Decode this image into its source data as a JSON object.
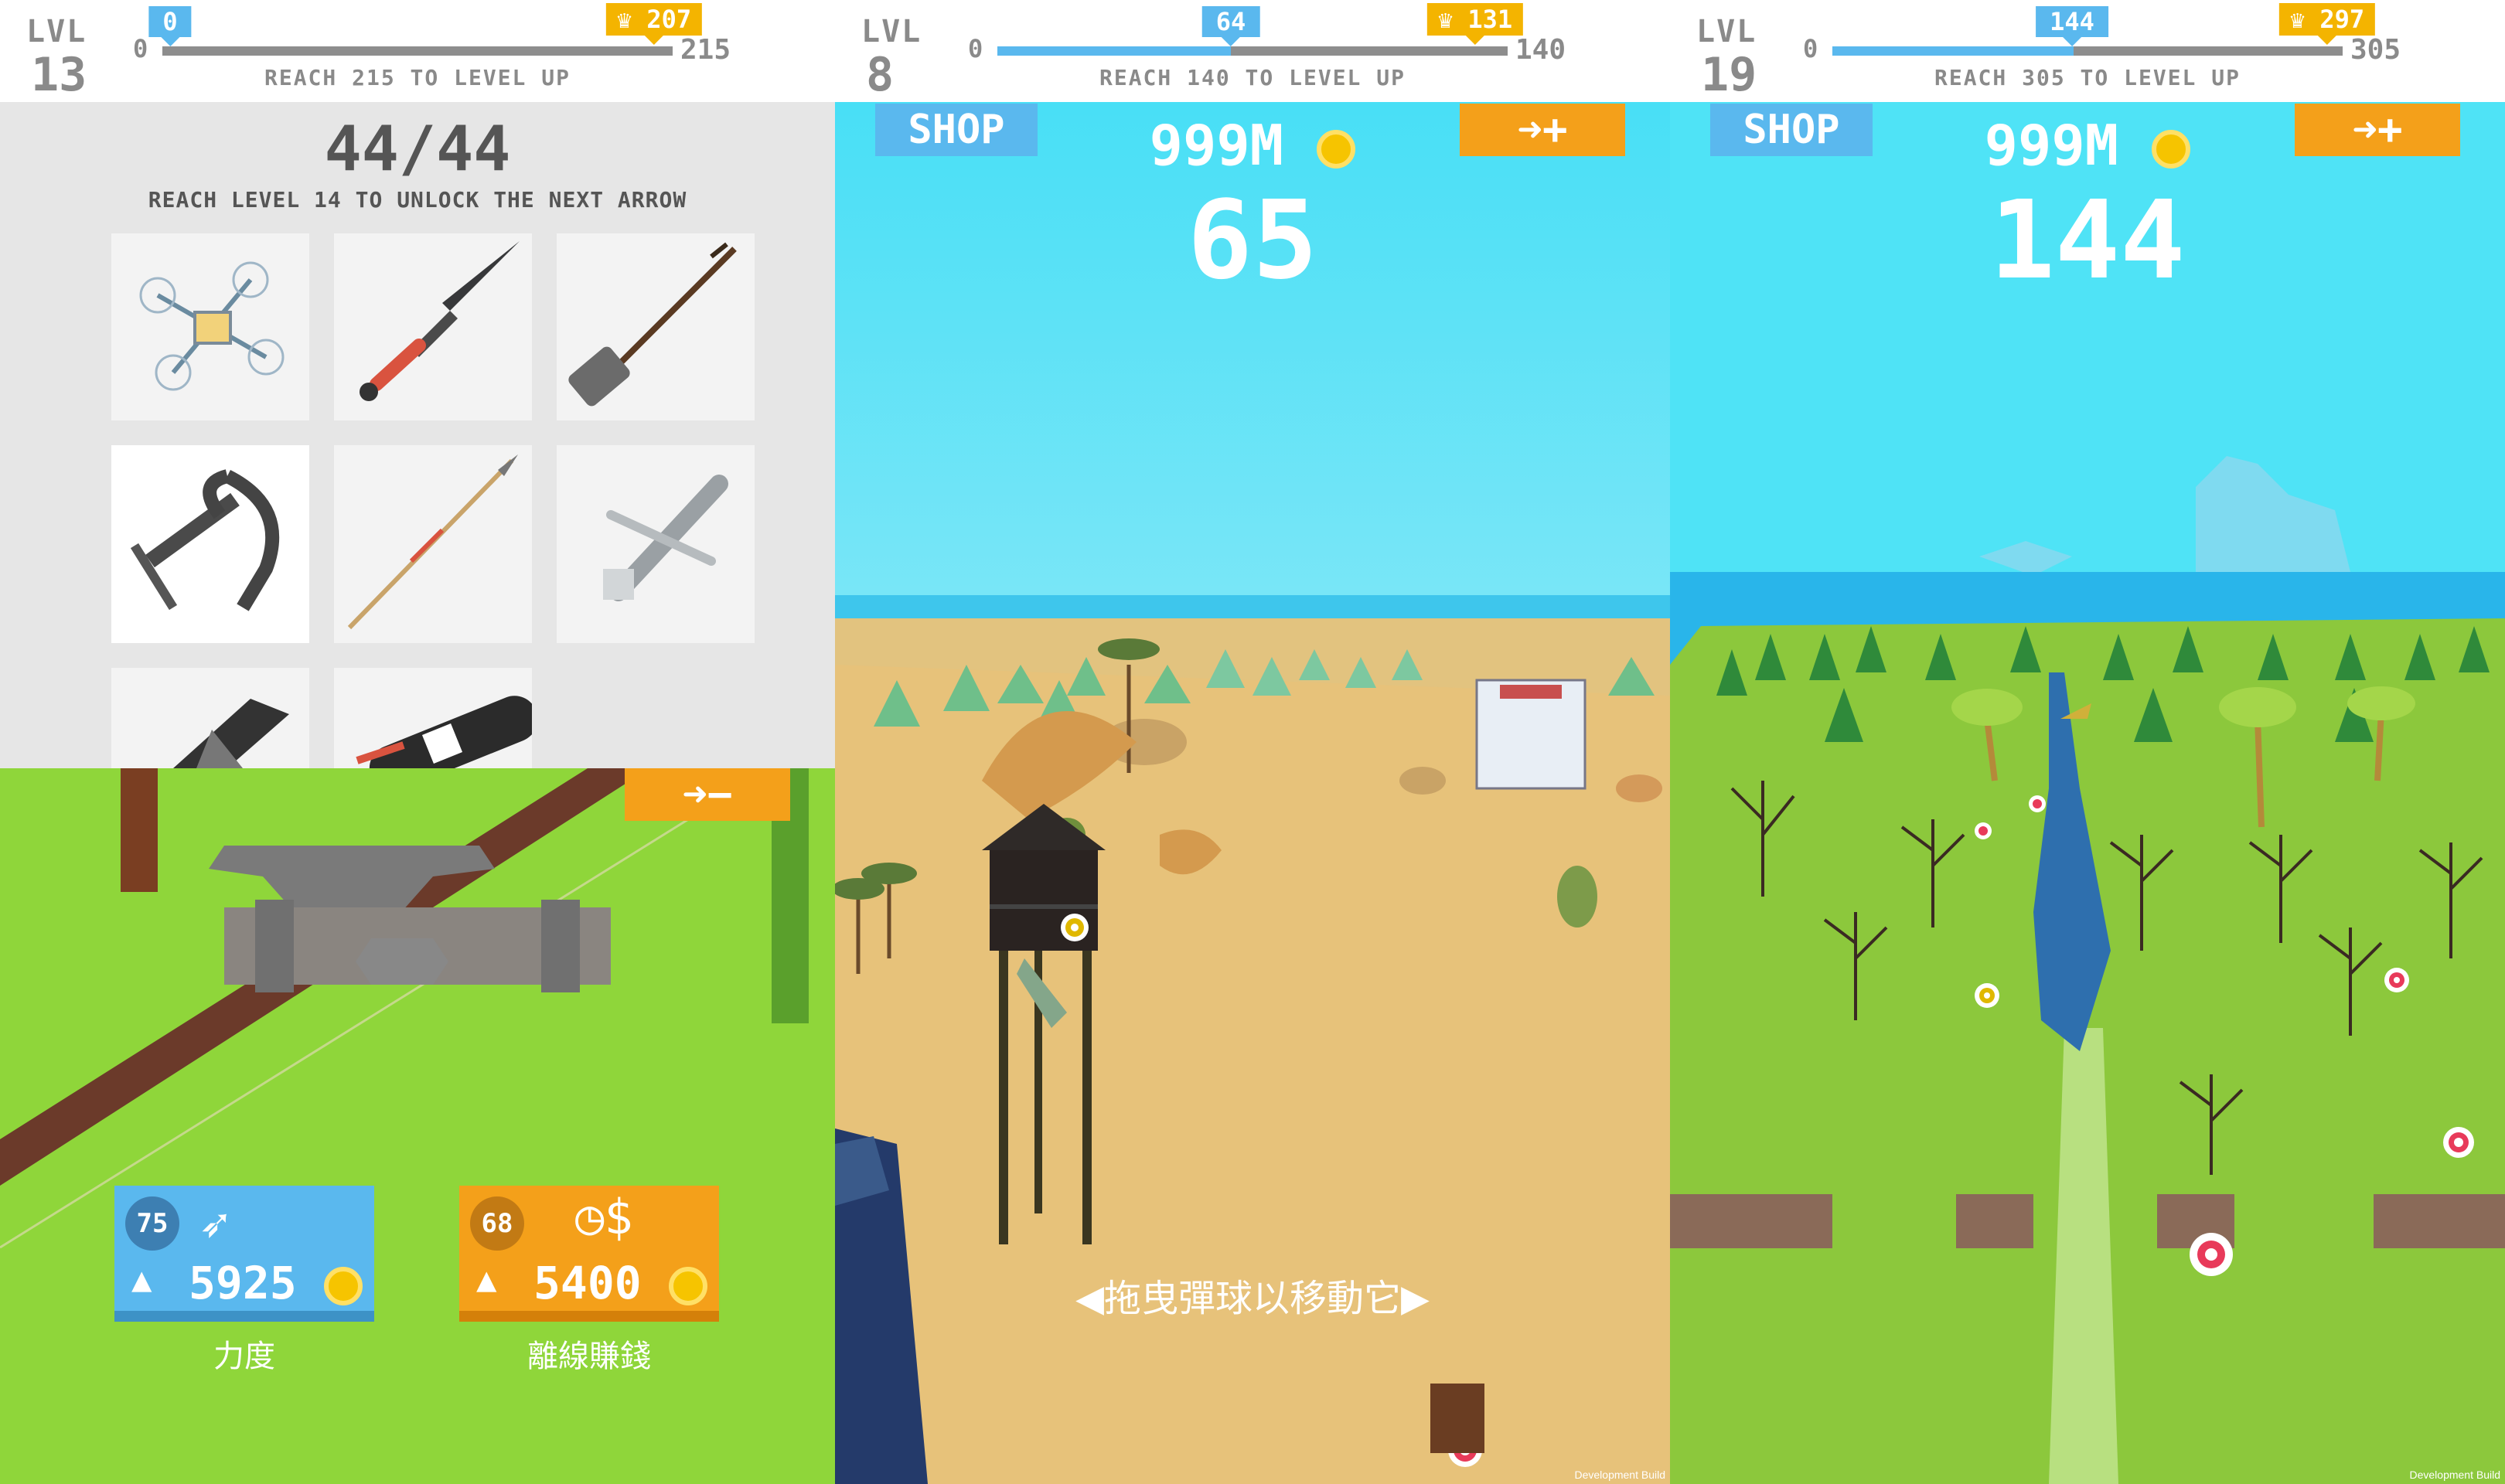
{
  "panels": [
    {
      "level": {
        "label": "LVL",
        "number": "13"
      },
      "progress": {
        "min": "0",
        "max": "215",
        "current": "0",
        "best": "207",
        "current_fraction": 0.0,
        "best_fraction": 0.963
      },
      "reach_text": "REACH 215 TO LEVEL UP"
    },
    {
      "level": {
        "label": "LVL",
        "number": "8"
      },
      "progress": {
        "min": "0",
        "max": "140",
        "current": "64",
        "best": "131",
        "current_fraction": 0.457,
        "best_fraction": 0.936
      },
      "reach_text": "REACH 140 TO LEVEL UP"
    },
    {
      "level": {
        "label": "LVL",
        "number": "19"
      },
      "progress": {
        "min": "0",
        "max": "305",
        "current": "144",
        "best": "297",
        "current_fraction": 0.472,
        "best_fraction": 0.974
      },
      "reach_text": "REACH 305 TO LEVEL UP"
    }
  ],
  "shop": {
    "count": "44/44",
    "unlock_text": "REACH LEVEL 14 TO UNLOCK THE NEXT ARROW",
    "arrows": [
      {
        "icon": "drone-icon"
      },
      {
        "icon": "kunai-icon"
      },
      {
        "icon": "guitar-icon"
      },
      {
        "icon": "anchor-icon",
        "selected": true
      },
      {
        "icon": "spear-icon"
      },
      {
        "icon": "plane-icon"
      },
      {
        "icon": "shark-icon"
      },
      {
        "icon": "missile-icon"
      }
    ]
  },
  "upgrade": {
    "arrow_minus_label": "➜−",
    "power": {
      "level": "75",
      "cost": "5925",
      "label": "力度",
      "arrow": "▲"
    },
    "offline": {
      "level": "68",
      "cost": "5400",
      "label": "離線賺錢",
      "arrow": "▲"
    }
  },
  "game": {
    "shop_label": "SHOP",
    "money": "999M",
    "arrow_plus_label": "➜+",
    "scores": [
      "65",
      "144"
    ],
    "drag_hint": "◀拖曳彈球以移動它▶",
    "dev_build": "Development Build"
  },
  "colors": {
    "blue": "#5ab8ee",
    "gold": "#f4b400",
    "orange": "#f4a01a",
    "grass": "#8fd63a",
    "sky": "#4fe3f6",
    "sand": "#e7c27a"
  }
}
